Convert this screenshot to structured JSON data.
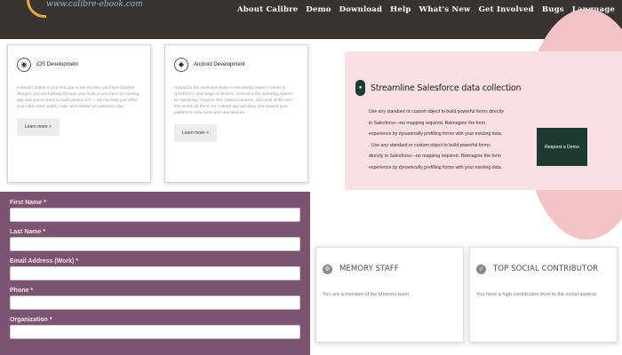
{
  "header": {
    "logo_text": "www.calibre-ebook.com",
    "nav": [
      "About Calibre",
      "Demo",
      "Download",
      "Help",
      "What's New",
      "Get Involved",
      "Bugs",
      "Language"
    ]
  },
  "services": [
    {
      "title": "iOS Development",
      "text": "It doesn't matter if your iOS app is just an idea, you have finished designs, you are halfway through your build or you have an existing app and you're ready to build version 2.0 — we can help you refine your idea, write quality code, and release an awesome app.",
      "button": "Learn more >"
    },
    {
      "title": "Android Development",
      "text": "Android is the dominant player in the market when it comes to QUANTITY and range of devices. Android is the operating system for Samsung, Amazon Fire, Zebra scanners, and most of the non-iOS world out there. An Android app will allow you expand your platform to new sizes and new devices.",
      "button": "Learn more >"
    }
  ],
  "form": {
    "fields": [
      {
        "label": "First Name *",
        "value": ""
      },
      {
        "label": "Last Name *",
        "value": ""
      },
      {
        "label": "Email Address (Work) *",
        "value": ""
      },
      {
        "label": "Phone *",
        "value": ""
      },
      {
        "label": "Organization *",
        "value": ""
      }
    ]
  },
  "promo": {
    "title": "Streamline Salesforce data collection",
    "lines": [
      "Use any standard or custom object to build powerful forms directly",
      "in Salesforce—no mapping required. Reimagine the form",
      "experience by dynamically prefilling forms with your existing data.",
      ". Use any standard or custom object to build powerful forms",
      "directly in Salesforce—no mapping required. Reimagine the form",
      "experience by dynamically prefilling forms with your existing data."
    ],
    "cta": "Request a Demo",
    "colors": {
      "accent": "#1d3b32",
      "band": "#f8e0e3",
      "circle": "#f4c3c6"
    }
  },
  "badges": [
    {
      "icon": "gear-icon",
      "title": "MEMORY STAFF",
      "text": "You are a member of the Memory team"
    },
    {
      "icon": "shield-check-icon",
      "title": "TOP SOCIAL CONTRIBUTOR",
      "text": "You have a high contribution level to the social aspects"
    }
  ],
  "colors": {
    "nav_bg": "#3a3430",
    "form_bg": "#7c5370"
  }
}
